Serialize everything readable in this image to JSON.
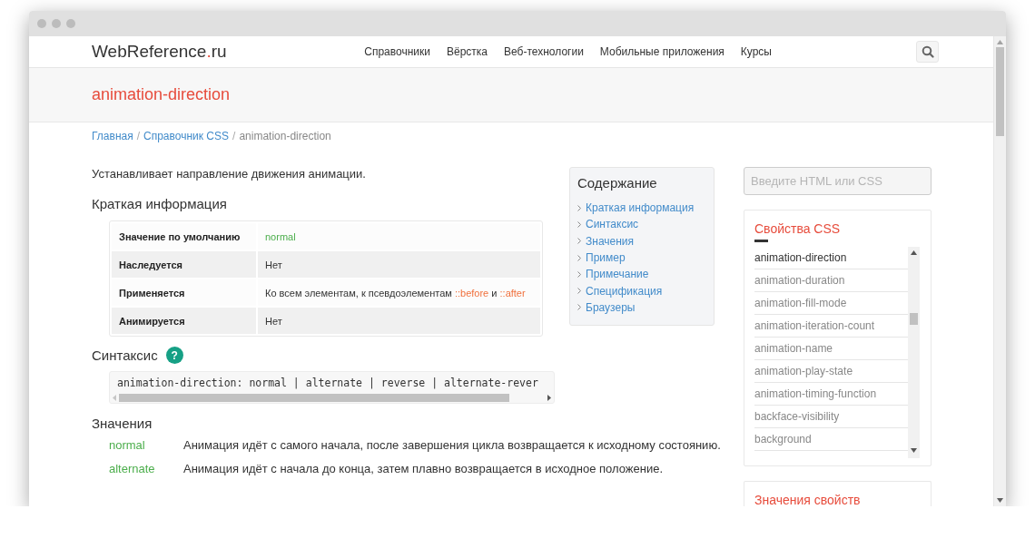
{
  "header": {
    "logo": [
      "WebReference",
      ".",
      "ru"
    ],
    "nav": [
      "Справочники",
      "Вёрстка",
      "Веб-технологии",
      "Мобильные приложения",
      "Курсы"
    ]
  },
  "page_title": "animation-direction",
  "breadcrumb": [
    {
      "text": "Главная",
      "kind": "link"
    },
    {
      "text": "/",
      "kind": "separator"
    },
    {
      "text": "Справочник CSS",
      "kind": "link"
    },
    {
      "text": "/",
      "kind": "separator"
    },
    {
      "text": "animation-direction",
      "kind": "current"
    }
  ],
  "intro": "Устанавливает направление движения анимации.",
  "summary": {
    "heading": "Краткая информация",
    "rows": [
      {
        "label": "Значение по умолчанию",
        "value": [
          {
            "text": "normal",
            "kind": "keyword"
          }
        ]
      },
      {
        "label": "Наследуется",
        "value": [
          {
            "text": "Нет",
            "kind": "text"
          }
        ]
      },
      {
        "label": "Применяется",
        "value": [
          {
            "text": "Ко всем элементам, к псевдоэлементам",
            "kind": "text"
          },
          {
            "text": "::before",
            "kind": "pseudo"
          },
          {
            "text": "и",
            "kind": "text"
          },
          {
            "text": "::after",
            "kind": "pseudo"
          }
        ]
      },
      {
        "label": "Анимируется",
        "value": [
          {
            "text": "Нет",
            "kind": "text"
          }
        ]
      }
    ]
  },
  "syntax": {
    "heading": "Синтаксис",
    "help": "?",
    "code": "animation-direction: normal | alternate | reverse | alternate-rever"
  },
  "values": {
    "heading": "Значения",
    "items": [
      {
        "name": "normal",
        "description": "Анимация идёт с самого начала, после завершения цикла возвращается к исходному состоянию."
      },
      {
        "name": "alternate",
        "description": "Анимация идёт с начала до конца, затем плавно возвращается в исходное положение."
      }
    ]
  },
  "toc": {
    "title": "Содержание",
    "items": [
      "Краткая информация",
      "Синтаксис",
      "Значения",
      "Пример",
      "Примечание",
      "Спецификация",
      "Браузеры"
    ]
  },
  "search": {
    "placeholder": "Введите HTML или CSS"
  },
  "properties": {
    "title": "Свойства CSS",
    "items": [
      {
        "name": "animation-direction",
        "selected": true
      },
      {
        "name": "animation-duration",
        "selected": false
      },
      {
        "name": "animation-fill-mode",
        "selected": false
      },
      {
        "name": "animation-iteration-count",
        "selected": false
      },
      {
        "name": "animation-name",
        "selected": false
      },
      {
        "name": "animation-play-state",
        "selected": false
      },
      {
        "name": "animation-timing-function",
        "selected": false
      },
      {
        "name": "backface-visibility",
        "selected": false
      },
      {
        "name": "background",
        "selected": false
      }
    ]
  },
  "property_values": {
    "title": "Значения свойств"
  }
}
